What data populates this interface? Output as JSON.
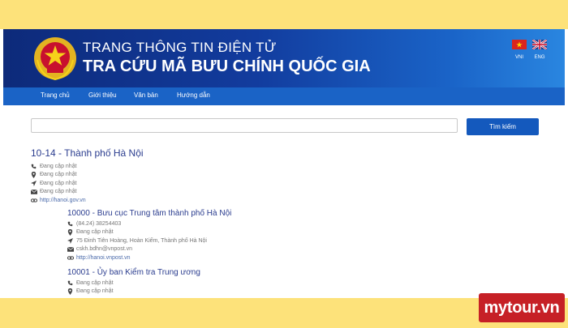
{
  "header": {
    "portal_title": "TRANG THÔNG TIN ĐIỆN TỬ",
    "site_title": "TRA CỨU MÃ BƯU CHÍNH QUỐC GIA",
    "languages": [
      "VNI",
      "ENG"
    ]
  },
  "nav": {
    "items": [
      "Trang chủ",
      "Giới thiệu",
      "Văn bản",
      "Hướng dẫn"
    ]
  },
  "search": {
    "value": "",
    "button_label": "Tìm kiếm"
  },
  "results": {
    "main": {
      "title": "10-14 - Thành phố Hà Nội",
      "phone": "Đang cập nhật",
      "location": "Đang cập nhật",
      "address": "Đang cập nhật",
      "email": "Đang cập nhật",
      "website": "http://hanoi.gov.vn"
    },
    "items": [
      {
        "title": "10000 - Bưu cục Trung tâm thành phố Hà Nội",
        "phone": "(84.24) 38254403",
        "location": "Đang cập nhật",
        "address": "75 Đinh Tiên Hoàng, Hoàn Kiếm, Thành phố Hà Nội",
        "email": "cskh.bdhn@vnpost.vn",
        "website": "http://hanoi.vnpost.vn"
      },
      {
        "title": "10001 - Ủy ban Kiểm tra Trung ương",
        "phone": "Đang cập nhật",
        "location": "Đang cập nhật"
      }
    ]
  },
  "watermark": "mytour.vn",
  "colors": {
    "banner_dark": "#0d2a7a",
    "banner_light": "#2a86e0",
    "nav": "#1a63c6",
    "button": "#1459bd",
    "link_title": "#2b3d8f",
    "frame": "#fde27a",
    "watermark_bg": "#c62026"
  },
  "icons": [
    "phone-icon",
    "map-marker-icon",
    "location-arrow-icon",
    "envelope-icon",
    "link-icon"
  ]
}
